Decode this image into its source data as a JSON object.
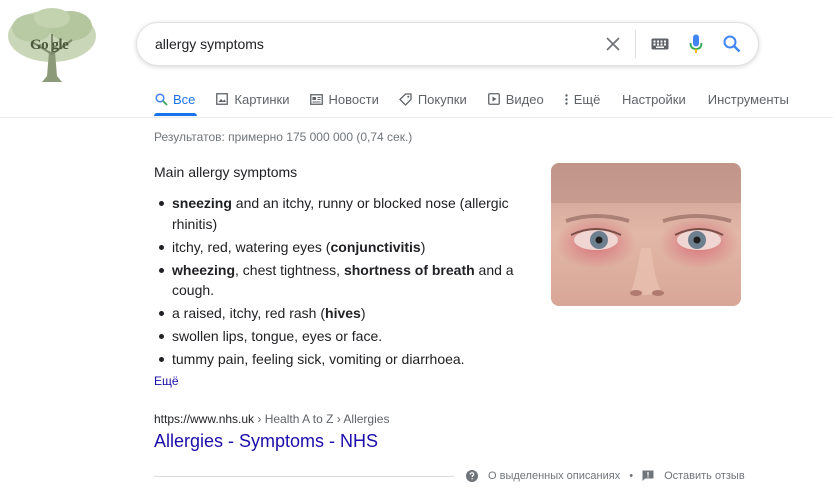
{
  "logo": {
    "text": "Go gle"
  },
  "search": {
    "query": "allergy symptoms"
  },
  "tabs": [
    {
      "label": "Все",
      "icon": "search-icon"
    },
    {
      "label": "Картинки",
      "icon": "image-icon"
    },
    {
      "label": "Новости",
      "icon": "news-icon"
    },
    {
      "label": "Покупки",
      "icon": "tag-icon"
    },
    {
      "label": "Видео",
      "icon": "video-icon"
    },
    {
      "label": "Ещё",
      "icon": "more-vert-icon"
    }
  ],
  "tools": {
    "settings": "Настройки",
    "tools": "Инструменты"
  },
  "result_stats": "Результатов: примерно 175 000 000 (0,74 сек.)",
  "snippet": {
    "title": "Main allergy symptoms",
    "items": [
      {
        "bold1": "sneezing",
        "text1": " and an itchy, runny or blocked nose (allergic rhinitis)"
      },
      {
        "text1": "itchy, red, watering eyes (",
        "bold1": "conjunctivitis",
        "text2": ")"
      },
      {
        "bold1": "wheezing",
        "text1": ", chest tightness, ",
        "bold2": "shortness of breath",
        "text2": " and a cough."
      },
      {
        "text1": "a raised, itchy, red rash (",
        "bold1": "hives",
        "text2": ")"
      },
      {
        "text1": "swollen lips, tongue, eyes or face."
      },
      {
        "text1": "tummy pain, feeling sick, vomiting or diarrhoea."
      }
    ],
    "more": "Ещё"
  },
  "result": {
    "domain": "https://www.nhs.uk",
    "breadcrumb": " › Health A to Z › Allergies",
    "title": "Allergies - Symptoms - NHS"
  },
  "footer": {
    "about": "О выделенных описаниях",
    "dot": "•",
    "feedback": "Оставить отзыв"
  },
  "colors": {
    "link": "#1a0dab",
    "accent": "#1a73e8",
    "muted": "#70757a"
  }
}
